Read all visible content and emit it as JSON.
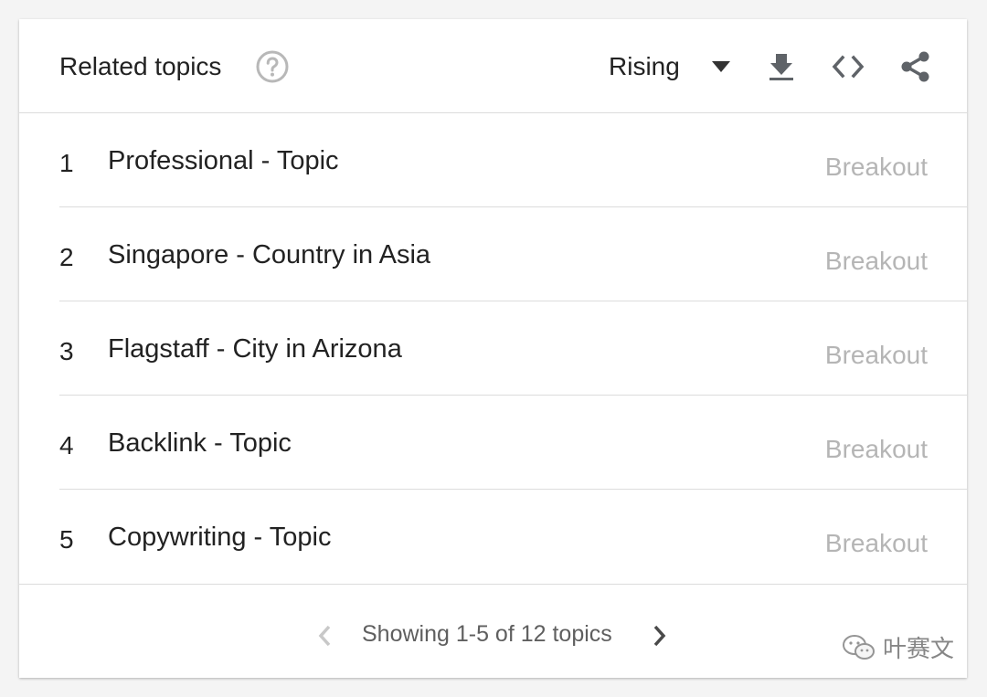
{
  "widget": {
    "title": "Related topics",
    "filter": "Rising"
  },
  "icons": {
    "help": "help-circle-icon",
    "dropdown": "triangle-down-icon",
    "download": "download-icon",
    "embed": "code-icon",
    "share": "share-icon",
    "prev": "chevron-left-icon",
    "next": "chevron-right-icon"
  },
  "rows": [
    {
      "rank": "1",
      "topic": "Professional - Topic",
      "value": "Breakout"
    },
    {
      "rank": "2",
      "topic": "Singapore - Country in Asia",
      "value": "Breakout"
    },
    {
      "rank": "3",
      "topic": "Flagstaff - City in Arizona",
      "value": "Breakout"
    },
    {
      "rank": "4",
      "topic": "Backlink - Topic",
      "value": "Breakout"
    },
    {
      "rank": "5",
      "topic": "Copywriting - Topic",
      "value": "Breakout"
    }
  ],
  "pagination": {
    "text": "Showing 1-5 of 12 topics"
  },
  "watermark": {
    "text": "叶赛文"
  },
  "colors": {
    "text": "#222222",
    "muted": "#b5b5b5",
    "icon": "#5f6368",
    "divider": "#dcdcdc"
  }
}
